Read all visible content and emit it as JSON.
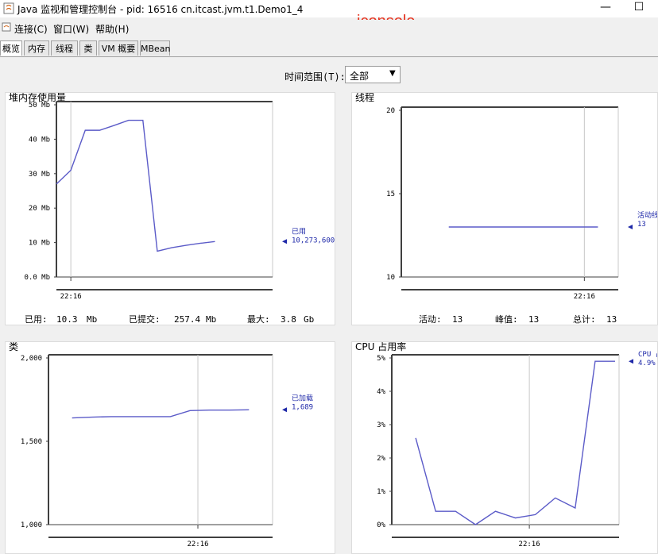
{
  "window": {
    "title": "Java 监视和管理控制台 - pid: 16516 cn.itcast.jvm.t1.Demo1_4",
    "overlay_text": "jconsole",
    "min_glyph": "—",
    "max_glyph": "☐"
  },
  "menu": {
    "items": [
      "连接(C)",
      "窗口(W)",
      "帮助(H)"
    ]
  },
  "tabs": {
    "items": [
      "概览",
      "内存",
      "线程",
      "类",
      "VM 概要",
      "MBean"
    ],
    "active": 0
  },
  "time_range": {
    "label": "时间范围(T):",
    "value": "全部"
  },
  "colors": {
    "line": "#5b5bc8",
    "label": "#1e28a8",
    "grid": "#c8c8c8",
    "axis": "#404040",
    "overlay": "#e5331f"
  },
  "chart_data": [
    {
      "type": "line",
      "title": "堆内存使用量",
      "y_ticks": [
        "50 Mb",
        "40 Mb",
        "30 Mb",
        "20 Mb",
        "10 Mb",
        "0.0 Mb"
      ],
      "ylim": [
        0,
        50
      ],
      "x_tick": "22:16",
      "series": [
        {
          "name": "已用",
          "x": [
            0,
            1,
            2,
            3,
            4,
            5,
            6,
            7,
            8,
            9,
            10,
            11
          ],
          "values": [
            27,
            31,
            42.6,
            42.6,
            44,
            45.5,
            45.5,
            7.5,
            8.5,
            9.2,
            9.8,
            10.3
          ]
        }
      ],
      "value_label": "10,273,600",
      "stats": [
        {
          "label": "已用:",
          "value": "10.3",
          "unit": "Mb"
        },
        {
          "label": "已提交:",
          "value": "257.4",
          "unit": "Mb"
        },
        {
          "label": "最大:",
          "value": "3.8",
          "unit": "Gb"
        }
      ]
    },
    {
      "type": "line",
      "title": "线程",
      "y_ticks": [
        "20",
        "15",
        "10"
      ],
      "ylim": [
        10,
        20
      ],
      "x_tick": "22:16",
      "series": [
        {
          "name": "活动线",
          "x": [
            0,
            11
          ],
          "values": [
            13,
            13
          ]
        }
      ],
      "value_label": "13",
      "stats": [
        {
          "label": "活动:",
          "value": "13",
          "unit": ""
        },
        {
          "label": "峰值:",
          "value": "13",
          "unit": ""
        },
        {
          "label": "总计:",
          "value": "13",
          "unit": ""
        }
      ]
    },
    {
      "type": "line",
      "title": "类",
      "y_ticks": [
        "2,000",
        "1,500",
        "1,000"
      ],
      "ylim": [
        1000,
        2000
      ],
      "x_tick": "22:16",
      "series": [
        {
          "name": "已加载",
          "x": [
            0,
            1,
            2,
            3,
            4,
            5,
            6,
            7,
            8,
            9
          ],
          "values": [
            1640,
            1645,
            1648,
            1648,
            1648,
            1648,
            1684,
            1687,
            1687,
            1689
          ]
        }
      ],
      "value_label": "1,689",
      "stats": []
    },
    {
      "type": "line",
      "title": "CPU 占用率",
      "y_ticks": [
        "5%",
        "4%",
        "3%",
        "2%",
        "1%",
        "0%"
      ],
      "ylim": [
        0,
        5
      ],
      "x_tick": "22:16",
      "series": [
        {
          "name": "CPU 占",
          "x": [
            0,
            1,
            2,
            3,
            4,
            5,
            6,
            7,
            8,
            9,
            10
          ],
          "values": [
            2.6,
            0.4,
            0.4,
            0.0,
            0.4,
            0.2,
            0.3,
            0.8,
            0.5,
            4.9,
            4.9
          ]
        }
      ],
      "value_label": "4.9%",
      "stats": []
    }
  ]
}
